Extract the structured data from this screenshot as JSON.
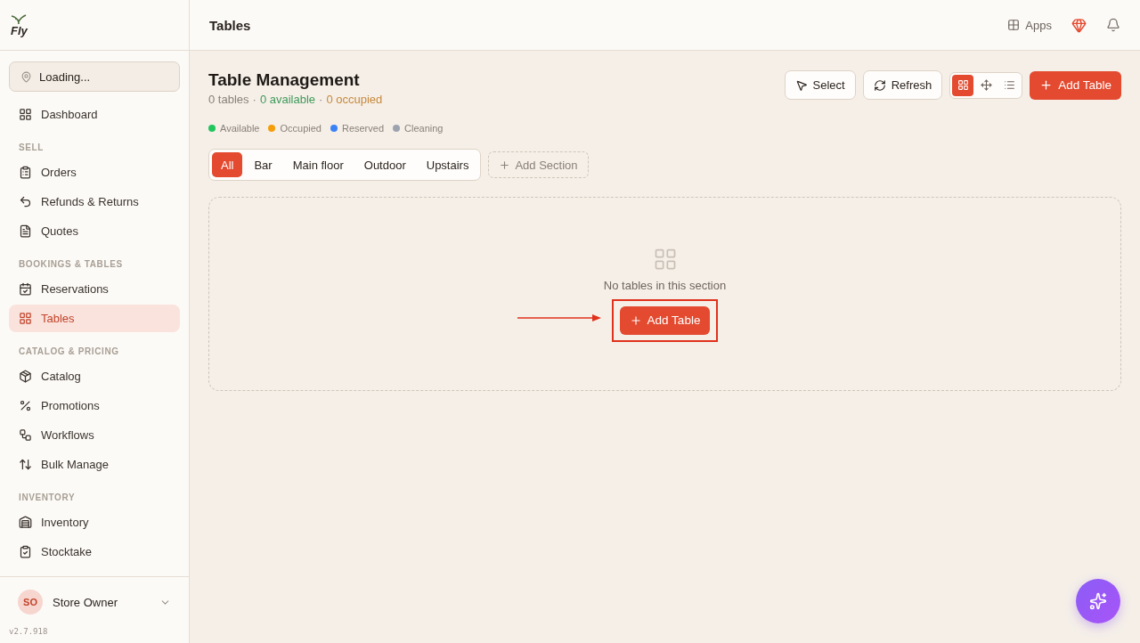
{
  "brand": {
    "logo": "Fly",
    "version": "v2.7.918"
  },
  "location": {
    "label": "Loading..."
  },
  "nav": [
    {
      "items": [
        {
          "label": "Dashboard",
          "selected": false
        }
      ]
    },
    {
      "heading": "SELL",
      "items": [
        {
          "label": "Orders",
          "selected": false
        },
        {
          "label": "Refunds & Returns",
          "selected": false
        },
        {
          "label": "Quotes",
          "selected": false
        }
      ]
    },
    {
      "heading": "BOOKINGS & TABLES",
      "items": [
        {
          "label": "Reservations",
          "selected": false
        },
        {
          "label": "Tables",
          "selected": true
        }
      ]
    },
    {
      "heading": "CATALOG & PRICING",
      "items": [
        {
          "label": "Catalog",
          "selected": false
        },
        {
          "label": "Promotions",
          "selected": false
        },
        {
          "label": "Workflows",
          "selected": false
        },
        {
          "label": "Bulk Manage",
          "selected": false
        }
      ]
    },
    {
      "heading": "INVENTORY",
      "items": [
        {
          "label": "Inventory",
          "selected": false
        },
        {
          "label": "Stocktake",
          "selected": false
        }
      ]
    }
  ],
  "user": {
    "initials": "SO",
    "name": "Store Owner"
  },
  "header": {
    "title": "Tables",
    "apps": "Apps"
  },
  "page": {
    "title": "Table Management",
    "summary": [
      {
        "kind": "total",
        "text": "0 tables"
      },
      {
        "kind": "separator",
        "text": "·"
      },
      {
        "kind": "available",
        "text": "0 available"
      },
      {
        "kind": "separator",
        "text": "·"
      },
      {
        "kind": "occupied",
        "text": "0 occupied"
      }
    ],
    "legend": [
      {
        "label": "Available",
        "color": "#22c55e"
      },
      {
        "label": "Occupied",
        "color": "#f59e0b"
      },
      {
        "label": "Reserved",
        "color": "#3b82f6"
      },
      {
        "label": "Cleaning",
        "color": "#9ca3af"
      }
    ],
    "toolbar": {
      "select": "Select",
      "refresh": "Refresh",
      "views": [
        {
          "selected": true
        },
        {
          "selected": false
        },
        {
          "selected": false
        }
      ],
      "add": "Add Table"
    },
    "sections": [
      {
        "label": "All",
        "selected": true
      },
      {
        "label": "Bar",
        "selected": false
      },
      {
        "label": "Main floor",
        "selected": false
      },
      {
        "label": "Outdoor",
        "selected": false
      },
      {
        "label": "Upstairs",
        "selected": false
      }
    ],
    "add_section": "Add Section",
    "empty": {
      "message": "No tables in this section",
      "button": "Add Table",
      "highlighted": true
    }
  }
}
